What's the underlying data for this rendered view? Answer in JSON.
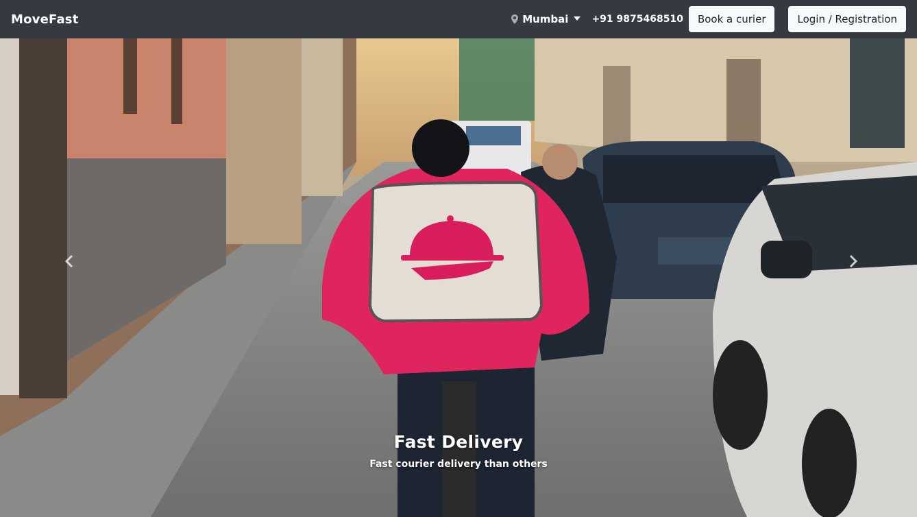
{
  "navbar": {
    "brand": "MoveFast",
    "city": "Mumbai",
    "phone": "+91 9875468510",
    "book_label": "Book a curier",
    "login_label": "Login / Registration"
  },
  "carousel": {
    "caption_title": "Fast Delivery",
    "caption_text": "Fast courier delivery than others"
  },
  "colors": {
    "navbar_bg": "#343a40",
    "button_bg": "#f8f9fa",
    "jacket_pink": "#e0245e"
  },
  "icons": {
    "city": "location-pin-icon",
    "prev": "chevron-left-icon",
    "next": "chevron-right-icon"
  }
}
